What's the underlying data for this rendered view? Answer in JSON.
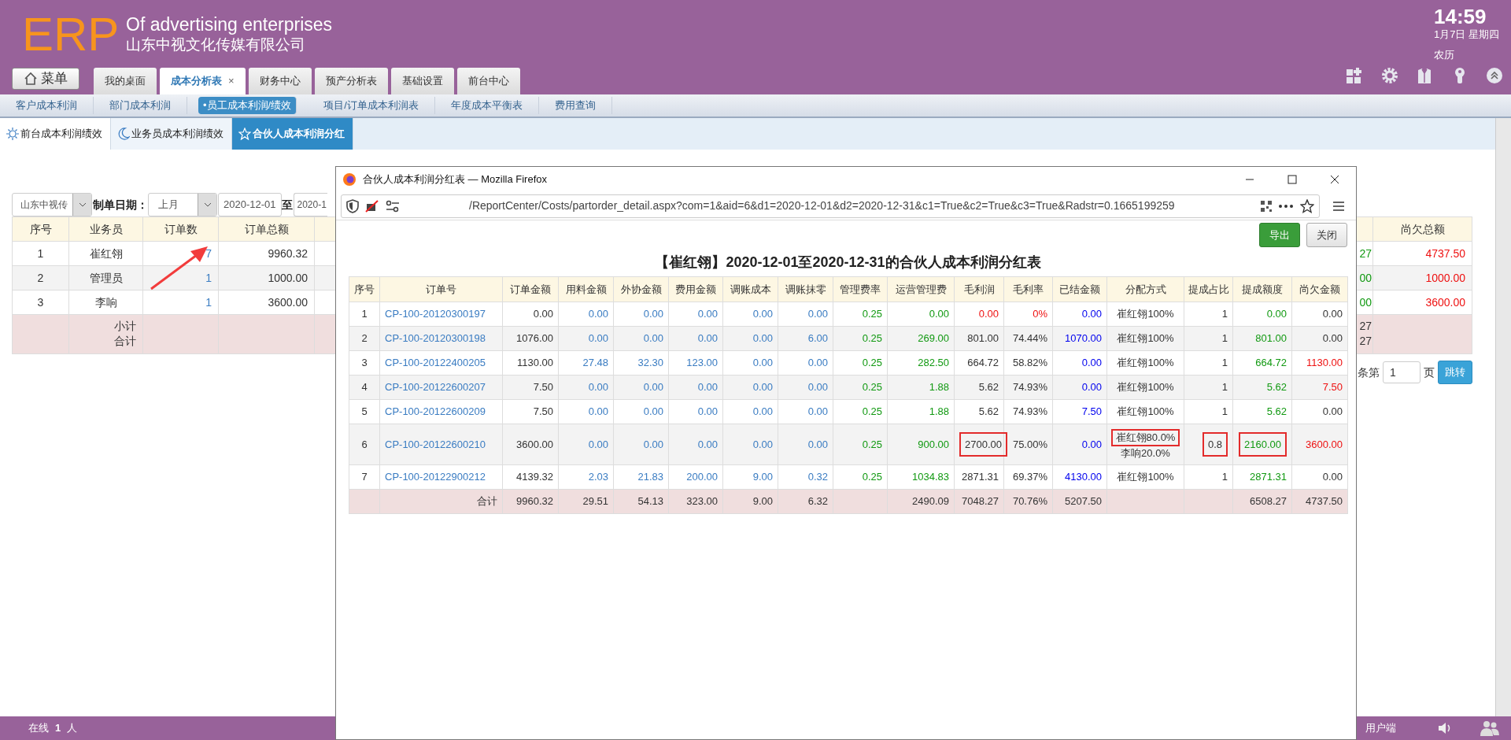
{
  "header": {
    "logo": "ERP",
    "title": "Of advertising enterprises",
    "company": "山东中视文化传媒有限公司",
    "menu_button": "菜单",
    "tabs": [
      {
        "label": "我的桌面",
        "selected": false
      },
      {
        "label": "成本分析表",
        "selected": true,
        "close": "×"
      },
      {
        "label": "财务中心",
        "selected": false
      },
      {
        "label": "预产分析表",
        "selected": false
      },
      {
        "label": "基础设置",
        "selected": false
      },
      {
        "label": "前台中心",
        "selected": false
      }
    ],
    "clock": {
      "time": "14:59",
      "date": "1月7日 星期四",
      "lunar": "农历"
    }
  },
  "subnav": [
    {
      "label": "客户成本利润",
      "selected": false
    },
    {
      "label": "部门成本利润",
      "selected": false
    },
    {
      "label": "•员工成本利润/绩效",
      "selected": true
    },
    {
      "label": "项目/订单成本利润表",
      "selected": false
    },
    {
      "label": "年度成本平衡表",
      "selected": false
    },
    {
      "label": "费用查询",
      "selected": false
    }
  ],
  "subtabs": [
    {
      "label": "前台成本利润绩效",
      "selected": false
    },
    {
      "label": "业务员成本利润绩效",
      "selected": false
    },
    {
      "label": "合伙人成本利润分红",
      "selected": true
    }
  ],
  "filter": {
    "company": "山东中视传",
    "date_label": "制单日期：",
    "period": "上月",
    "date_from": "2020-12-01",
    "to_label": "至",
    "date_to": "2020-1"
  },
  "summary_table": {
    "columns": [
      {
        "label": "序号",
        "kind": "text"
      },
      {
        "label": "业务员",
        "kind": "text"
      },
      {
        "label": "订单数",
        "kind": "link"
      },
      {
        "label": "订单总额",
        "kind": "text"
      },
      {
        "kind": "fee"
      },
      {
        "label": "尚欠总额",
        "kind": "alert"
      }
    ],
    "rows": [
      {
        "kind": "data",
        "cells": [
          "1",
          "崔红翎",
          "7",
          "9960.32",
          "27",
          "4737.50"
        ]
      },
      {
        "kind": "data",
        "cells": [
          "2",
          "管理员",
          "1",
          "1000.00",
          "00",
          "1000.00"
        ]
      },
      {
        "kind": "data",
        "cells": [
          "3",
          "李响",
          "1",
          "3600.00",
          "00",
          "3600.00"
        ]
      },
      {
        "kind": "subtotal",
        "cells_by_column": {
          "1": [
            "小计",
            "合计"
          ],
          "4": [
            "27",
            "27"
          ]
        }
      }
    ]
  },
  "pager": {
    "prefix": "条第",
    "page": "1",
    "suffix": "页",
    "go_button": "跳转"
  },
  "popup": {
    "window_title": "合伙人成本利润分红表 — Mozilla Firefox",
    "url": "/ReportCenter/Costs/partorder_detail.aspx?com=1&aid=6&d1=2020-12-01&d2=2020-12-31&c1=True&c2=True&c3=True&Radstr=0.1665199259",
    "buttons": [
      {
        "label": "导出",
        "kind": "export"
      },
      {
        "label": "关闭",
        "kind": "close"
      }
    ],
    "report_title": "【崔红翎】2020-12-01至2020-12-31的合伙人成本利润分红表",
    "table": {
      "columns": [
        {
          "label": "序号",
          "kind": "text"
        },
        {
          "label": "订单号",
          "kind": "link"
        },
        {
          "label": "订单金额",
          "kind": "text"
        },
        {
          "label": "用料金额",
          "kind": "link"
        },
        {
          "label": "外协金额",
          "kind": "link"
        },
        {
          "label": "费用金额",
          "kind": "link"
        },
        {
          "label": "调账成本",
          "kind": "link"
        },
        {
          "label": "调账抹零",
          "kind": "link"
        },
        {
          "label": "管理费率",
          "kind": "fee"
        },
        {
          "label": "运营管理费",
          "kind": "fee"
        },
        {
          "label": "毛利润",
          "kind": "text"
        },
        {
          "label": "毛利率",
          "kind": "text"
        },
        {
          "label": "已结金额",
          "kind": "paid"
        },
        {
          "label": "分配方式",
          "kind": "text"
        },
        {
          "label": "提成占比",
          "kind": "text"
        },
        {
          "label": "提成额度",
          "kind": "fee"
        },
        {
          "label": "尚欠金额",
          "kind": "text"
        }
      ],
      "rows": [
        {
          "kind": "data",
          "cells": [
            "1",
            "CP-100-20120300197",
            "0.00",
            "0.00",
            "0.00",
            "0.00",
            "0.00",
            "0.00",
            "0.25",
            "0.00",
            {
              "text": "0.00",
              "kind": "alert"
            },
            {
              "text": "0%",
              "kind": "alert"
            },
            "0.00",
            "崔红翎100%",
            "1",
            "0.00",
            "0.00"
          ]
        },
        {
          "kind": "data",
          "cells": [
            "2",
            "CP-100-20120300198",
            "1076.00",
            "0.00",
            "0.00",
            "0.00",
            "0.00",
            "6.00",
            "0.25",
            "269.00",
            "801.00",
            "74.44%",
            "1070.00",
            "崔红翎100%",
            "1",
            "801.00",
            "0.00"
          ]
        },
        {
          "kind": "data",
          "cells": [
            "3",
            "CP-100-20122400205",
            "1130.00",
            "27.48",
            "32.30",
            "123.00",
            "0.00",
            "0.00",
            "0.25",
            "282.50",
            "664.72",
            "58.82%",
            "0.00",
            "崔红翎100%",
            "1",
            "664.72",
            {
              "text": "1130.00",
              "kind": "alert"
            }
          ]
        },
        {
          "kind": "data",
          "cells": [
            "4",
            "CP-100-20122600207",
            "7.50",
            "0.00",
            "0.00",
            "0.00",
            "0.00",
            "0.00",
            "0.25",
            "1.88",
            "5.62",
            "74.93%",
            "0.00",
            "崔红翎100%",
            "1",
            "5.62",
            {
              "text": "7.50",
              "kind": "alert"
            }
          ]
        },
        {
          "kind": "data",
          "cells": [
            "5",
            "CP-100-20122600209",
            "7.50",
            "0.00",
            "0.00",
            "0.00",
            "0.00",
            "0.00",
            "0.25",
            "1.88",
            "5.62",
            "74.93%",
            "7.50",
            "崔红翎100%",
            "1",
            "5.62",
            "0.00"
          ]
        },
        {
          "kind": "data",
          "cells": [
            "6",
            "CP-100-20122600210",
            "3600.00",
            "0.00",
            "0.00",
            "0.00",
            "0.00",
            "0.00",
            "0.25",
            "900.00",
            {
              "text": "2700.00",
              "boxed": true
            },
            "75.00%",
            "0.00",
            {
              "lines": [
                {
                  "text": "崔红翎80.0%",
                  "boxed": true
                },
                {
                  "text": "李响20.0%",
                  "boxed": false
                }
              ]
            },
            {
              "text": "0.8",
              "boxed": true
            },
            {
              "text": "2160.00",
              "boxed": true
            },
            {
              "text": "3600.00",
              "kind": "alert"
            }
          ]
        },
        {
          "kind": "data",
          "cells": [
            "7",
            "CP-100-20122900212",
            "4139.32",
            "2.03",
            "21.83",
            "200.00",
            "9.00",
            "0.32",
            "0.25",
            "1034.83",
            "2871.31",
            "69.37%",
            "4130.00",
            "崔红翎100%",
            "1",
            "2871.31",
            "0.00"
          ]
        },
        {
          "kind": "total",
          "cells_by_column": {
            "1": "合计",
            "2": "9960.32",
            "3": "29.51",
            "4": "54.13",
            "5": "323.00",
            "6": "9.00",
            "7": "6.32",
            "9": "2490.09",
            "10": "7048.27",
            "11": "70.76%",
            "12": "5207.50",
            "15": "6508.27",
            "16": "4737.50"
          }
        }
      ]
    }
  },
  "status_bar": {
    "online_label": "在线",
    "online_count": "1",
    "online_unit": "人",
    "client_label": "用户端"
  }
}
